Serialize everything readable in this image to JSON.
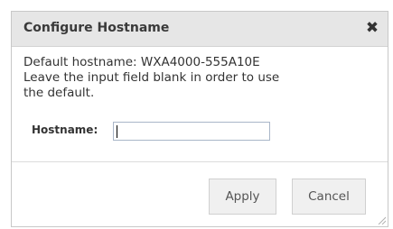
{
  "dialog": {
    "title": "Configure Hostname",
    "close_glyph": "✖",
    "close_icon": "close-x-icon",
    "message_line1": "Default hostname: WXA4000-555A10E",
    "message_line2": "Leave the input field blank in order to use",
    "message_line3": "the default.",
    "hostname_label": "Hostname:",
    "hostname_value": "",
    "apply_label": "Apply",
    "cancel_label": "Cancel",
    "resize_icon": "resize-grip-icon"
  }
}
